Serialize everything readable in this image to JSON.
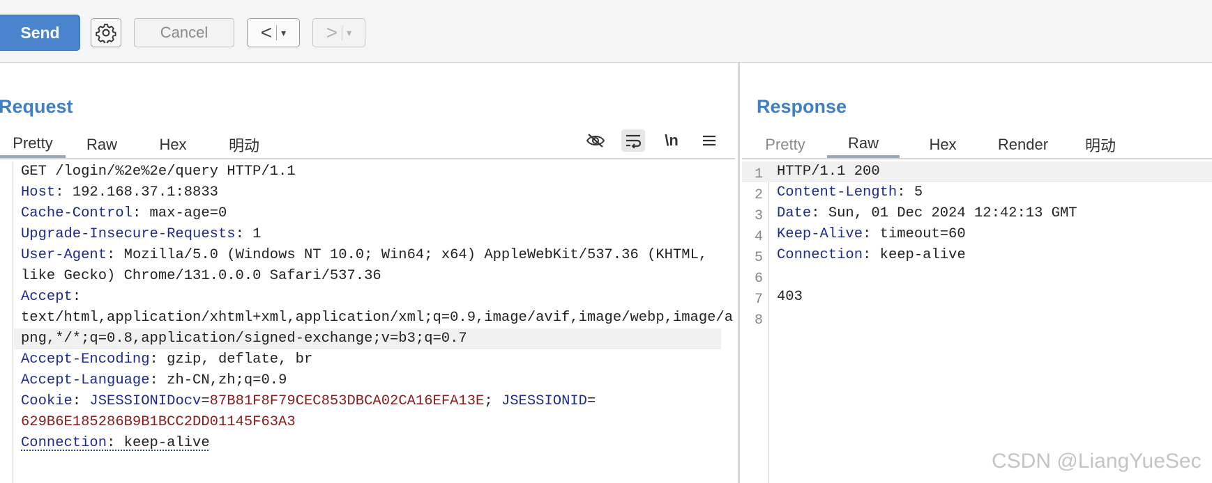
{
  "toolbar": {
    "send_label": "Send",
    "cancel_label": "Cancel",
    "back_glyph": "<",
    "forward_glyph": ">",
    "dropdown_glyph": "▾"
  },
  "request": {
    "title": "Request",
    "tabs": [
      "Pretty",
      "Raw",
      "Hex",
      "明动"
    ],
    "active_tab": "Pretty",
    "tools": {
      "newline_label": "\\n",
      "icons": [
        "eye-slash-icon",
        "wrap-icon",
        "newline-icon",
        "menu-icon"
      ]
    },
    "lines": {
      "l1": "GET /login/%2e%2e/query HTTP/1.1",
      "host_key": "Host",
      "host_val": "192.168.37.1:8833",
      "cache_key": "Cache-Control",
      "cache_val": "max-age=0",
      "upgrade_key": "Upgrade-Insecure-Requests",
      "upgrade_val": "1",
      "ua_key": "User-Agent",
      "ua_val1": "Mozilla/5.0 (Windows NT 10.0; Win64; x64) AppleWebKit/537.36 (KHTML,",
      "ua_val2": "like Gecko) Chrome/131.0.0.0 Safari/537.36",
      "accept_key": "Accept",
      "accept_val1": "text/html,application/xhtml+xml,application/xml;q=0.9,image/avif,image/webp,image/a",
      "accept_val2": "png,*/*;q=0.8,application/signed-exchange;v=b3;q=0.7",
      "enc_key": "Accept-Encoding",
      "enc_val": "gzip, deflate, br",
      "lang_key": "Accept-Language",
      "lang_val": "zh-CN,zh;q=0.9",
      "cookie_key": "Cookie",
      "cookie1_name": "JSESSIONIDocv",
      "cookie1_val": "87B81F8F79CEC853DBCA02CA16EFA13E",
      "cookie2_name": "JSESSIONID",
      "cookie2_val": "629B6E185286B9B1BCC2DD01145F63A3",
      "conn_key": "Connection",
      "conn_val": "keep-alive"
    }
  },
  "response": {
    "title": "Response",
    "tabs": [
      "Pretty",
      "Raw",
      "Hex",
      "Render",
      "明动"
    ],
    "active_tab": "Raw",
    "line_numbers": [
      "1",
      "2",
      "3",
      "4",
      "5",
      "6",
      "7",
      "8"
    ],
    "lines": {
      "status": "HTTP/1.1 200",
      "cl_key": "Content-Length",
      "cl_val": "5",
      "date_key": "Date",
      "date_val": "Sun, 01 Dec 2024 12:42:13 GMT",
      "ka_key": "Keep-Alive",
      "ka_val": "timeout=60",
      "conn_key": "Connection",
      "conn_val": "keep-alive",
      "body": "403"
    }
  },
  "watermark": "CSDN @LiangYueSec",
  "colors": {
    "accent": "#4a84cc",
    "title": "#3f7fc2",
    "header_key": "#1d2a8f",
    "cookie_value": "#8b1a1a"
  }
}
